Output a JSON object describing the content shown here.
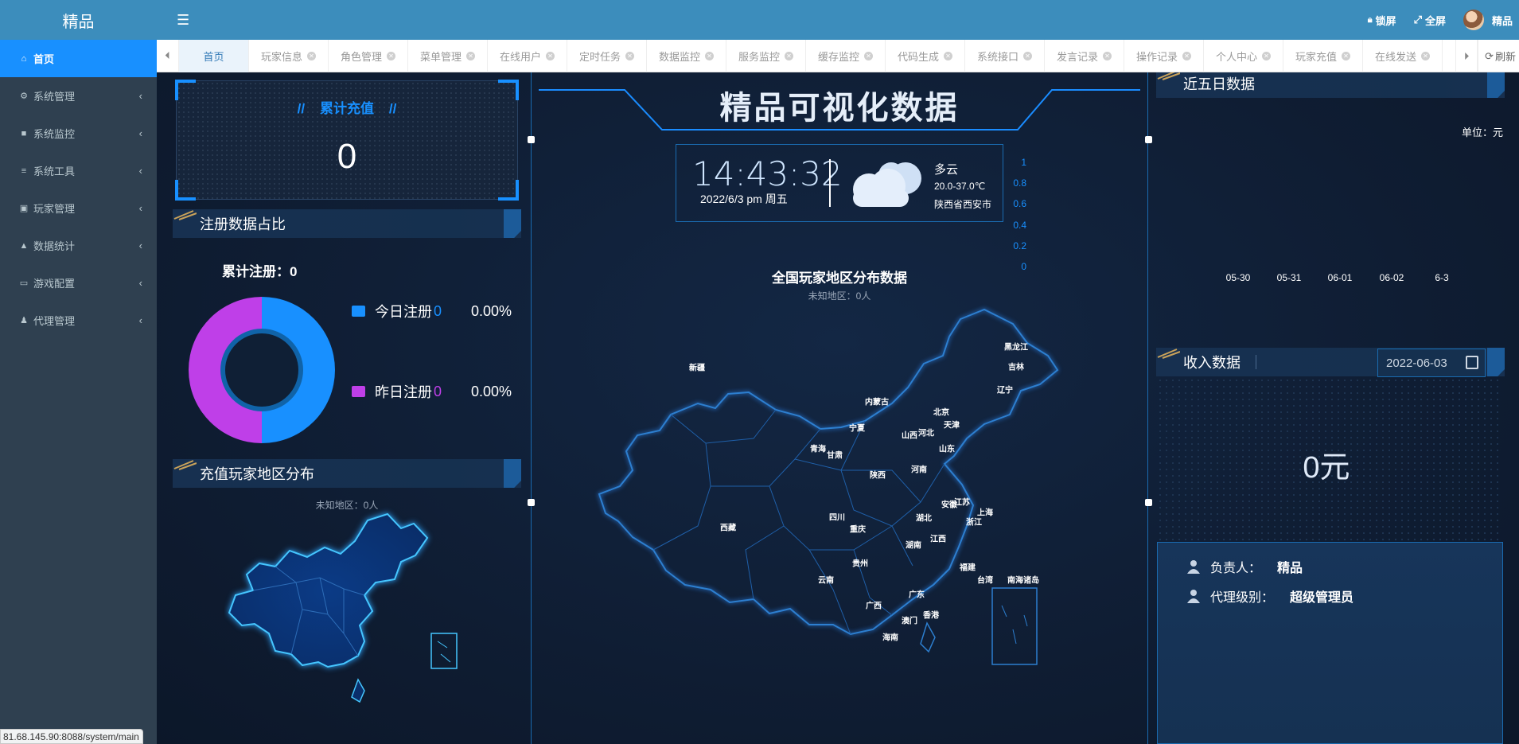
{
  "app": {
    "logo": "精品"
  },
  "sidebar": {
    "items": [
      {
        "label": "首页",
        "icon": "home-icon",
        "active": true
      },
      {
        "label": "系统管理",
        "icon": "gear-icon"
      },
      {
        "label": "系统监控",
        "icon": "video-icon"
      },
      {
        "label": "系统工具",
        "icon": "list-icon"
      },
      {
        "label": "玩家管理",
        "icon": "id-card-icon"
      },
      {
        "label": "数据统计",
        "icon": "area-chart-icon"
      },
      {
        "label": "游戏配置",
        "icon": "monitor-icon"
      },
      {
        "label": "代理管理",
        "icon": "users-icon"
      }
    ]
  },
  "topbar": {
    "lock_label": "锁屏",
    "fullscreen_label": "全屏",
    "user_name": "精品"
  },
  "tabs": {
    "items": [
      "首页",
      "玩家信息",
      "角色管理",
      "菜单管理",
      "在线用户",
      "定时任务",
      "数据监控",
      "服务监控",
      "缓存监控",
      "代码生成",
      "系统接口",
      "发言记录",
      "操作记录",
      "个人中心",
      "玩家充值",
      "在线发送"
    ],
    "refresh_label": "刷新"
  },
  "recharge": {
    "title": "累计充值",
    "value": "0"
  },
  "register": {
    "header": "注册数据占比",
    "total_label": "累计注册：",
    "total_value": "0",
    "today_label": "今日注册",
    "today_value": "0",
    "today_pct": "0.00%",
    "yesterday_label": "昨日注册",
    "yesterday_value": "0",
    "yesterday_pct": "0.00%",
    "colors": {
      "today": "#1890ff",
      "yesterday": "#bf3fe8"
    }
  },
  "recharge_map": {
    "header": "充值玩家地区分布",
    "unknown": "未知地区：0人"
  },
  "center": {
    "title": "精品可视化数据",
    "time": "14:43:32",
    "date": "2022/6/3  pm  周五",
    "weather": "多云",
    "temperature": "20.0-37.0℃",
    "location": "陕西省西安市",
    "map_title": "全国玩家地区分布数据",
    "map_unknown": "未知地区：0人",
    "provinces": [
      "黑龙江",
      "吉林",
      "辽宁",
      "内蒙古",
      "北京",
      "天津",
      "河北",
      "山西",
      "山东",
      "新疆",
      "宁夏",
      "青海",
      "甘肃",
      "陕西",
      "河南",
      "江苏",
      "安徽",
      "上海",
      "浙江",
      "湖北",
      "四川",
      "重庆",
      "西藏",
      "湖南",
      "江西",
      "福建",
      "台湾",
      "南海诸岛",
      "云南",
      "贵州",
      "广西",
      "广东",
      "香港",
      "澳门",
      "海南"
    ]
  },
  "five_day": {
    "header": "近五日数据",
    "unit": "单位：元"
  },
  "chart_data": {
    "type": "bar",
    "categories": [
      "05-30",
      "05-31",
      "06-01",
      "06-02",
      "6-3"
    ],
    "values": [
      0,
      0,
      0,
      0,
      0
    ],
    "yticks": [
      "1",
      "0.8",
      "0.6",
      "0.4",
      "0.2",
      "0"
    ],
    "ylim": [
      0,
      1
    ],
    "title": "近五日数据"
  },
  "income": {
    "header": "收入数据",
    "date": "2022-06-03",
    "value": "0元",
    "manager_label": "负责人：",
    "manager_value": "精品",
    "level_label": "代理级别：",
    "level_value": "超级管理员"
  },
  "statusbar": {
    "url": "81.68.145.90:8088/system/main"
  }
}
